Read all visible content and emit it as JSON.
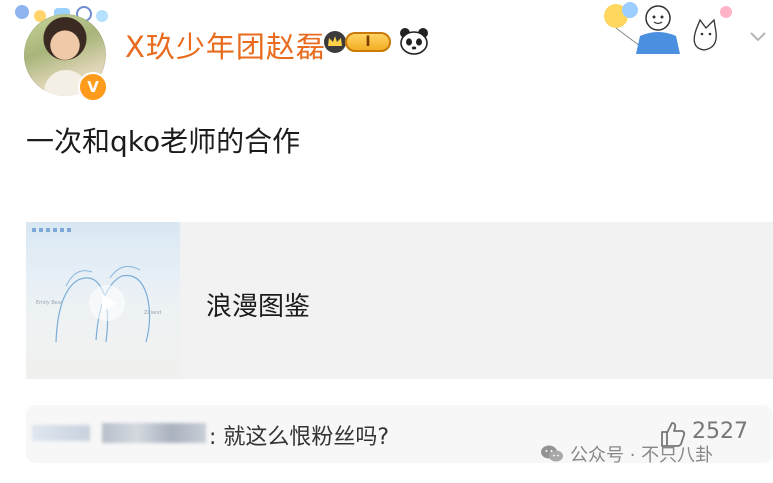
{
  "header": {
    "username": "X玖少年团赵磊",
    "vip_level": "I",
    "verified_badge": "V"
  },
  "post": {
    "text": "一次和qko老师的合作"
  },
  "media_card": {
    "title": "浪漫图鉴"
  },
  "comment": {
    "text": ": 就这么恨粉丝吗?",
    "likes": "2527"
  },
  "watermark": {
    "text": "公众号 · 不只八卦"
  },
  "colors": {
    "username": "#e86b1e",
    "verified": "#ff9b1a",
    "card_bg": "#f2f2f2"
  },
  "icons": [
    "avatar",
    "verified-badge",
    "vip-crown-icon",
    "panda-icon",
    "chevron-down-icon",
    "play-icon",
    "like-icon",
    "wechat-icon"
  ]
}
